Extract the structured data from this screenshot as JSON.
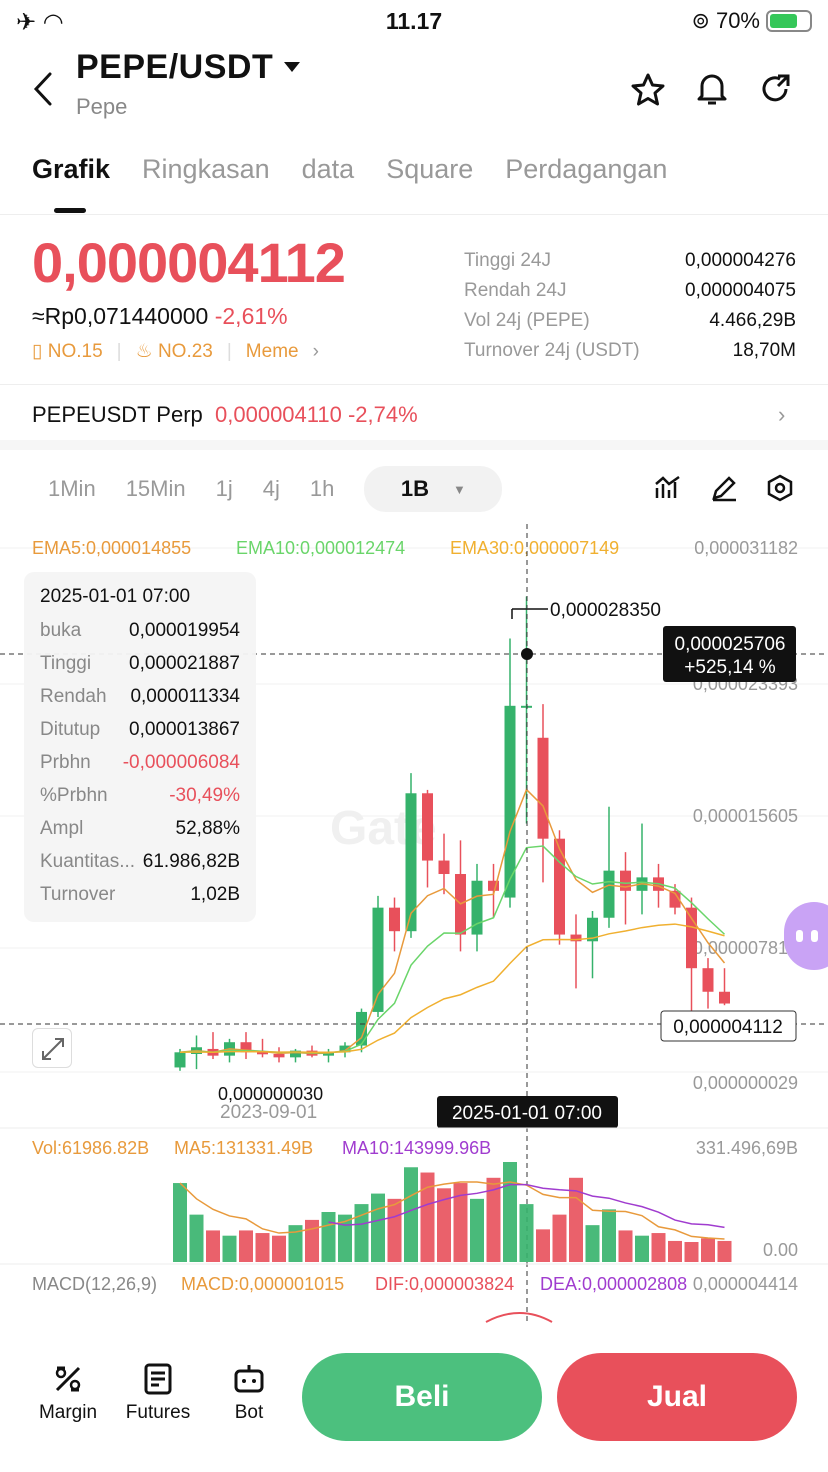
{
  "status_bar": {
    "time": "11.17",
    "battery_pct": "70%",
    "battery_level": 0.7
  },
  "header": {
    "pair": "PEPE/USDT",
    "name": "Pepe"
  },
  "tabs": [
    "Grafik",
    "Ringkasan",
    "data",
    "Square",
    "Perdagangan"
  ],
  "price": {
    "last": "0,000004112",
    "fiat": "≈Rp0,071440000",
    "change": "-2,61%"
  },
  "ranks": {
    "rank1": "NO.15",
    "rank2": "NO.23",
    "tag": "Meme"
  },
  "stats": [
    {
      "label": "Tinggi 24J",
      "value": "0,000004276"
    },
    {
      "label": "Rendah 24J",
      "value": "0,000004075"
    },
    {
      "label": "Vol 24j (PEPE)",
      "value": "4.466,29B"
    },
    {
      "label": "Turnover 24j (USDT)",
      "value": "18,70M"
    }
  ],
  "perp": {
    "name": "PEPEUSDT Perp",
    "price": "0,000004110",
    "change": "-2,74%"
  },
  "timeframes": {
    "options": [
      "1Min",
      "15Min",
      "1j",
      "4j",
      "1h"
    ],
    "selected": "1B"
  },
  "chart": {
    "ema5": "EMA5:0,000014855",
    "ema10": "EMA10:0,000012474",
    "ema30": "EMA30:0,000007149",
    "axis": [
      "0,000031182",
      "0,000023393",
      "0,000015605",
      "0,000007817",
      "0,000000029"
    ],
    "high_label": "0,000028350",
    "low_label": "0,000000030",
    "cross_price": "0,000025706",
    "cross_pct": "+525,14 %",
    "last_price_tag": "0,000004112",
    "date_axis": "2023-09-01",
    "cross_date": "2025-01-01 07:00"
  },
  "tooltip": {
    "date": "2025-01-01 07:00",
    "rows": [
      {
        "label": "buka",
        "value": "0,000019954"
      },
      {
        "label": "Tinggi",
        "value": "0,000021887"
      },
      {
        "label": "Rendah",
        "value": "0,000011334"
      },
      {
        "label": "Ditutup",
        "value": "0,000013867"
      },
      {
        "label": "Prbhn",
        "value": "-0,000006084"
      },
      {
        "label": "%Prbhn",
        "value": "-30,49%"
      },
      {
        "label": "Ampl",
        "value": "52,88%"
      },
      {
        "label": "Kuantitas...",
        "value": "61.986,82B"
      },
      {
        "label": "Turnover",
        "value": "1,02B"
      }
    ]
  },
  "volume": {
    "vol": "Vol:61986.82B",
    "ma5": "MA5:131331.49B",
    "ma10": "MA10:143999.96B",
    "max": "331.496,69B",
    "zero": "0.00"
  },
  "macd": {
    "label": "MACD(12,26,9)",
    "macd": "MACD:0,000001015",
    "dif": "DIF:0,000003824",
    "dea": "DEA:0,000002808",
    "max": "0,000004414"
  },
  "bottom_nav": {
    "margin": "Margin",
    "futures": "Futures",
    "bot": "Bot",
    "buy": "Beli",
    "sell": "Jual"
  },
  "colors": {
    "up": "#35b26b",
    "down": "#e8505b",
    "accent": "#e89a3c",
    "ma10": "#a03ccf"
  },
  "chart_data": {
    "type": "candlestick",
    "candles": [
      {
        "o": 3e-07,
        "h": 1.4e-06,
        "l": 1e-07,
        "c": 1.2e-06
      },
      {
        "o": 1.1e-06,
        "h": 2.2e-06,
        "l": 2e-07,
        "c": 1.5e-06
      },
      {
        "o": 1.4e-06,
        "h": 2.4e-06,
        "l": 8e-07,
        "c": 1e-06
      },
      {
        "o": 1e-06,
        "h": 2e-06,
        "l": 6e-07,
        "c": 1.8e-06
      },
      {
        "o": 1.8e-06,
        "h": 2.4e-06,
        "l": 8e-07,
        "c": 1.2e-06
      },
      {
        "o": 1.2e-06,
        "h": 2e-06,
        "l": 9e-07,
        "c": 1.1e-06
      },
      {
        "o": 1.1e-06,
        "h": 1.5e-06,
        "l": 6e-07,
        "c": 9e-07
      },
      {
        "o": 9e-07,
        "h": 1.4e-06,
        "l": 6e-07,
        "c": 1.3e-06
      },
      {
        "o": 1.3e-06,
        "h": 1.6e-06,
        "l": 9e-07,
        "c": 1e-06
      },
      {
        "o": 1e-06,
        "h": 1.4e-06,
        "l": 6e-07,
        "c": 1.2e-06
      },
      {
        "o": 1.2e-06,
        "h": 1.8e-06,
        "l": 9e-07,
        "c": 1.6e-06
      },
      {
        "o": 1.6e-06,
        "h": 3.8e-06,
        "l": 1.2e-06,
        "c": 3.6e-06
      },
      {
        "o": 3.6e-06,
        "h": 1.05e-05,
        "l": 3.3e-06,
        "c": 9.8e-06
      },
      {
        "o": 9.8e-06,
        "h": 1.04e-05,
        "l": 7.2e-06,
        "c": 8.4e-06
      },
      {
        "o": 8.4e-06,
        "h": 1.78e-05,
        "l": 8e-06,
        "c": 1.66e-05
      },
      {
        "o": 1.66e-05,
        "h": 1.68e-05,
        "l": 1.1e-05,
        "c": 1.26e-05
      },
      {
        "o": 1.26e-05,
        "h": 1.42e-05,
        "l": 1.06e-05,
        "c": 1.18e-05
      },
      {
        "o": 1.18e-05,
        "h": 1.38e-05,
        "l": 7.2e-06,
        "c": 8.2e-06
      },
      {
        "o": 8.2e-06,
        "h": 1.24e-05,
        "l": 7.2e-06,
        "c": 1.14e-05
      },
      {
        "o": 1.14e-05,
        "h": 1.24e-05,
        "l": 9.2e-06,
        "c": 1.08e-05
      },
      {
        "o": 1.04e-05,
        "h": 2.58e-05,
        "l": 9.8e-06,
        "c": 2.18e-05
      },
      {
        "o": 2.18e-05,
        "h": 2.83e-05,
        "l": 1.48e-05,
        "c": 2.18e-05
      },
      {
        "o": 1.99e-05,
        "h": 2.19e-05,
        "l": 1.13e-05,
        "c": 1.39e-05
      },
      {
        "o": 1.39e-05,
        "h": 1.44e-05,
        "l": 7.6e-06,
        "c": 8.2e-06
      },
      {
        "o": 8.2e-06,
        "h": 9.4e-06,
        "l": 5e-06,
        "c": 7.8e-06
      },
      {
        "o": 7.8e-06,
        "h": 9.6e-06,
        "l": 5.6e-06,
        "c": 9.2e-06
      },
      {
        "o": 9.2e-06,
        "h": 1.58e-05,
        "l": 8.6e-06,
        "c": 1.2e-05
      },
      {
        "o": 1.2e-05,
        "h": 1.31e-05,
        "l": 8.8e-06,
        "c": 1.08e-05
      },
      {
        "o": 1.08e-05,
        "h": 1.48e-05,
        "l": 9.4e-06,
        "c": 1.16e-05
      },
      {
        "o": 1.16e-05,
        "h": 1.24e-05,
        "l": 9.8e-06,
        "c": 1.08e-05
      },
      {
        "o": 1.08e-05,
        "h": 1.12e-05,
        "l": 9.4e-06,
        "c": 9.8e-06
      },
      {
        "o": 9.8e-06,
        "h": 1.04e-05,
        "l": 3.1e-06,
        "c": 6.2e-06
      },
      {
        "o": 6.2e-06,
        "h": 6.8e-06,
        "l": 3.8e-06,
        "c": 4.8e-06
      },
      {
        "o": 4.8e-06,
        "h": 6.2e-06,
        "l": 4e-06,
        "c": 4.1e-06
      }
    ],
    "volumes": [
      150,
      90,
      60,
      50,
      60,
      55,
      50,
      70,
      80,
      95,
      90,
      110,
      130,
      120,
      180,
      170,
      140,
      150,
      120,
      160,
      190,
      110,
      62,
      90,
      160,
      70,
      100,
      60,
      50,
      55,
      40,
      38,
      45,
      40
    ],
    "ylim": [
      2.9e-08,
      3.1182e-05
    ]
  }
}
